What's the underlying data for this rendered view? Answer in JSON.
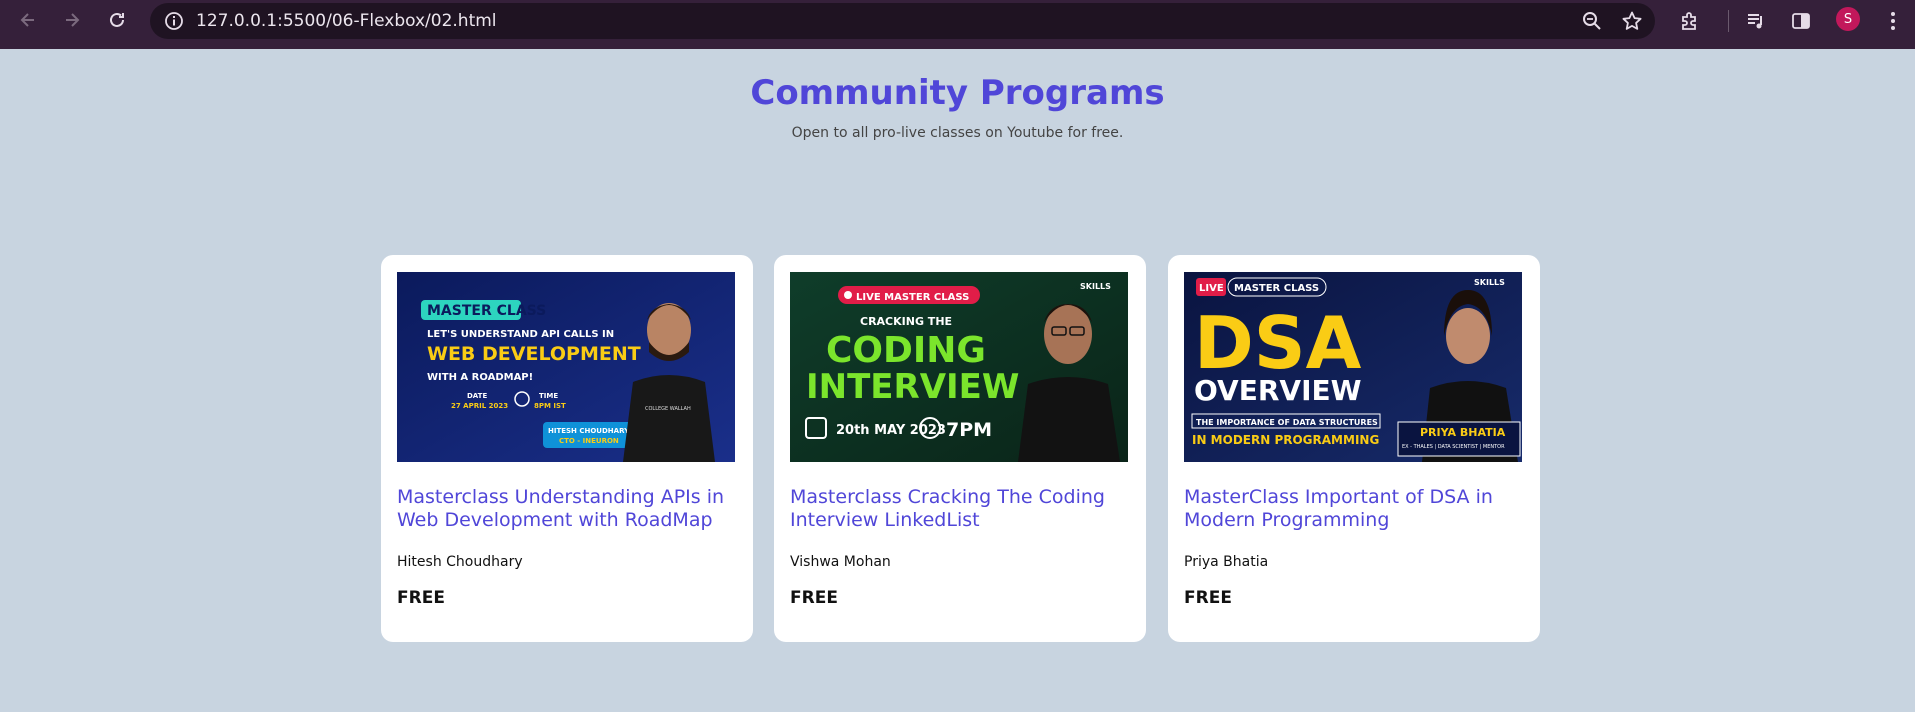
{
  "browser": {
    "url": "127.0.0.1:5500/06-Flexbox/02.html",
    "profile_initial": "S"
  },
  "header": {
    "title": "Community Programs",
    "subtitle": "Open to all pro-live classes on Youtube for free."
  },
  "cards": [
    {
      "title": "Masterclass Understanding APIs in Web Development with RoadMap",
      "author": "Hitesh Choudhary",
      "price": "FREE",
      "thumb": {
        "badge": "MASTER CLASS",
        "line1": "LET'S UNDERSTAND API CALLS IN",
        "line2": "WEB DEVELOPMENT",
        "line3": "WITH A ROADMAP!",
        "date_label": "DATE",
        "date": "27 APRIL 2023",
        "time_label": "TIME",
        "time": "8PM IST",
        "speaker": "HITESH CHOUDHARY",
        "speaker_role": "CTO - INEURON",
        "shirt": "COLLEGE WALLAH"
      }
    },
    {
      "title": "Masterclass Cracking The Coding Interview LinkedList",
      "author": "Vishwa Mohan",
      "price": "FREE",
      "thumb": {
        "badge": "LIVE MASTER CLASS",
        "brand": "SKILLS",
        "line1": "CRACKING THE",
        "line2": "CODING",
        "line3": "INTERVIEW",
        "date": "20th MAY 2023",
        "time": "7PM"
      }
    },
    {
      "title": "MasterClass Important of DSA in Modern Programming",
      "author": "Priya Bhatia",
      "price": "FREE",
      "thumb": {
        "badge_live": "LIVE",
        "badge": "MASTER CLASS",
        "brand": "SKILLS",
        "line1": "DSA",
        "line2": "OVERVIEW",
        "line3": "THE IMPORTANCE OF DATA STRUCTURES",
        "line4": "IN MODERN PROGRAMMING",
        "speaker": "PRIYA BHATIA",
        "speaker_role": "EX - THALES | DATA SCIENTIST | MENTOR"
      }
    }
  ],
  "colors": {
    "accent": "#5046d8",
    "background": "#c8d4e0",
    "chrome": "#35203a"
  },
  "icons": [
    "back-arrow-icon",
    "forward-arrow-icon",
    "reload-icon",
    "site-info-icon",
    "zoom-icon",
    "star-icon",
    "extensions-icon",
    "media-icon",
    "side-panel-icon",
    "menu-icon"
  ]
}
